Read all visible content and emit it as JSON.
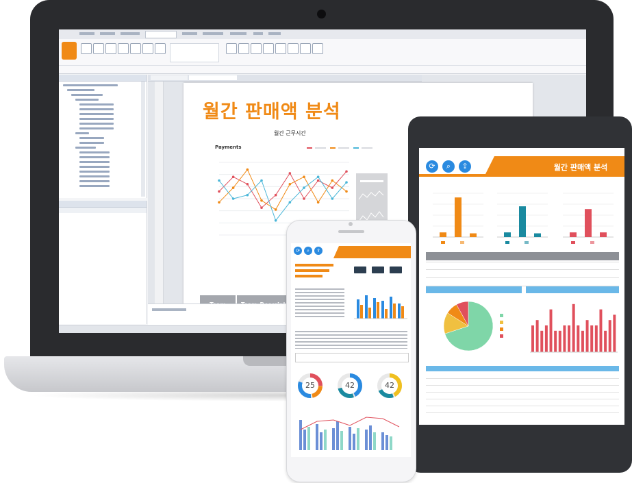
{
  "laptop": {
    "report_title": "월간 판매액 분석",
    "chart_title": "월간 근무시간",
    "chart_label": "Payments",
    "table_header_left": "Team",
    "table_header_right": "Team_Description"
  },
  "tablet": {
    "title": "월간 판매액 분석"
  },
  "phone": {
    "donut_values": [
      "25",
      "42",
      "42"
    ]
  },
  "colors": {
    "accent_orange": "#f08a16",
    "blue": "#2a8ae0",
    "teal": "#1a8aa0",
    "red": "#e0505c",
    "green_pie": "#7fd6a8"
  },
  "chart_data": [
    {
      "type": "line",
      "title": "월간 근무시간",
      "series": [
        {
          "values": [
            64,
            72,
            68,
            55,
            62,
            74,
            60,
            70,
            66,
            75
          ]
        },
        {
          "values": [
            58,
            66,
            76,
            59,
            54,
            68,
            72,
            58,
            70,
            64
          ]
        },
        {
          "values": [
            70,
            60,
            62,
            70,
            48,
            58,
            66,
            72,
            60,
            69
          ]
        }
      ]
    },
    {
      "type": "bar",
      "values": [
        1,
        8.5,
        0.8
      ],
      "color": "#f08a16"
    },
    {
      "type": "bar",
      "values": [
        1,
        6.6,
        0.8
      ],
      "color": "#1a8aa0"
    },
    {
      "type": "bar",
      "values": [
        1,
        6,
        1
      ],
      "color": "#e0505c"
    },
    {
      "type": "pie",
      "values": [
        70,
        14,
        8,
        8
      ]
    },
    {
      "type": "bar",
      "values": [
        5,
        6,
        4,
        5,
        8,
        4,
        4,
        5,
        5,
        9,
        5,
        4,
        6,
        5,
        5,
        8,
        4,
        6,
        7
      ]
    }
  ]
}
